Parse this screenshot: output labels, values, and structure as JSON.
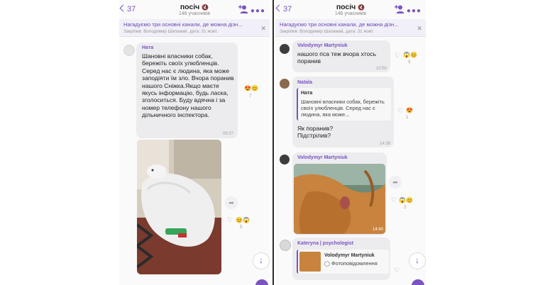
{
  "header": {
    "back_count": "37",
    "title": "посіч",
    "subtitle": "146 учасників"
  },
  "pinned": {
    "text": "Нагадуємо три основні канали, де можна дізн...",
    "meta": "Закріпив: Володимир Шапамай, дата: 31 жовт."
  },
  "left": {
    "message1": {
      "sender": "Ната",
      "text": "Шановні власники собак, бережіть своїх улюбленців. Серед нас є людина, яка може заподіяти їм зло. Вчора поранив нашого Сніжка.Якщо маєте якусь інформацію, будь ласка, зголоситься. Буду вдячна і за номер телефону нашого дільничного інспектора.",
      "time": "09:37",
      "reaction_count": "7"
    },
    "photo_reaction_count": "5"
  },
  "right": {
    "message1": {
      "sender": "Volodymyr Martyniuk",
      "text": "нашого пса теж вчора хтось поранив",
      "time": "10:50",
      "reaction_count": "3"
    },
    "message2": {
      "sender": "Natala",
      "quote_author": "Ната",
      "quote_text": "Шановні власники собак, бережіть своїх улюбленців. Серед нас є людина, яка може...",
      "text": "Як поранив? Підстрілив?",
      "time": "14:39",
      "reaction_count": "1"
    },
    "message3": {
      "sender": "Volodymyr Martyniuk",
      "time": "14:40",
      "reaction_count": "2"
    },
    "message4": {
      "sender": "Kateryna | psychologist",
      "quote_author": "Volodymyr Martyniuk",
      "quote_text": "Фотоповідомлення"
    }
  }
}
